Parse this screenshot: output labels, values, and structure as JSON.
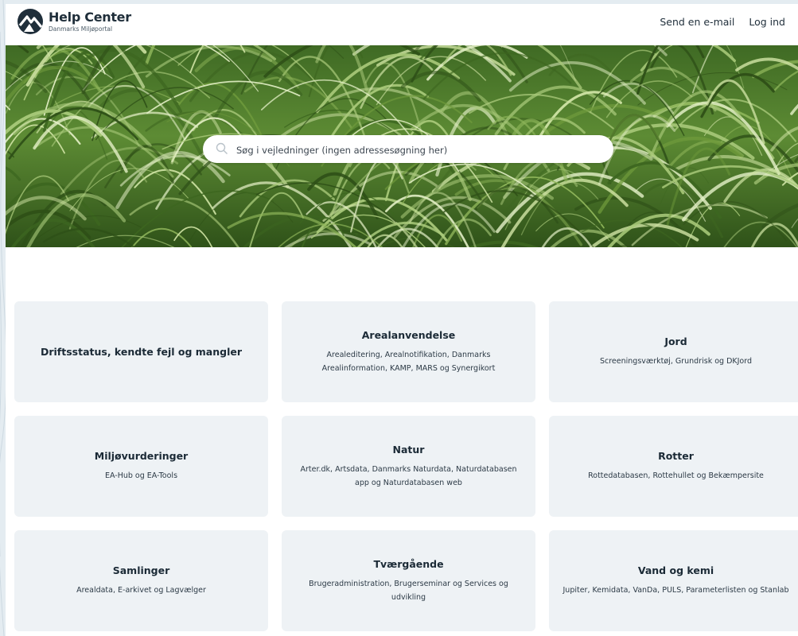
{
  "header": {
    "logo_title": "Help Center",
    "logo_subtitle": "Danmarks Miljøportal",
    "nav": {
      "email_label": "Send en e-mail",
      "login_label": "Log ind"
    }
  },
  "search": {
    "placeholder": "Søg i vejledninger (ingen adressesøgning her)"
  },
  "categories": [
    {
      "title": "Driftsstatus, kendte fejl og mangler",
      "description": ""
    },
    {
      "title": "Arealanvendelse",
      "description": "Arealeditering, Arealnotifikation, Danmarks Arealinformation, KAMP, MARS og Synergikort"
    },
    {
      "title": "Jord",
      "description": "Screeningsværktøj, Grundrisk og DKJord"
    },
    {
      "title": "Miljøvurderinger",
      "description": "EA-Hub og EA-Tools"
    },
    {
      "title": "Natur",
      "description": "Arter.dk, Artsdata, Danmarks Naturdata, Naturdatabasen app og Naturdatabasen web"
    },
    {
      "title": "Rotter",
      "description": "Rottedatabasen, Rottehullet og Bekæmpersite"
    },
    {
      "title": "Samlinger",
      "description": "Arealdata, E-arkivet og Lagvælger"
    },
    {
      "title": "Tværgående",
      "description": "Brugeradministration, Brugerseminar og Services og udvikling"
    },
    {
      "title": "Vand og kemi",
      "description": "Jupiter, Kemidata, VanDa, PULS, Parameterlisten og Stanlab"
    }
  ],
  "colors": {
    "card_background": "#eef2f5",
    "text_dark": "#1b2a36",
    "hero_grass": "#4e7a2c"
  },
  "icons": {
    "search": "search-icon",
    "logo": "logo-mark-icon"
  }
}
